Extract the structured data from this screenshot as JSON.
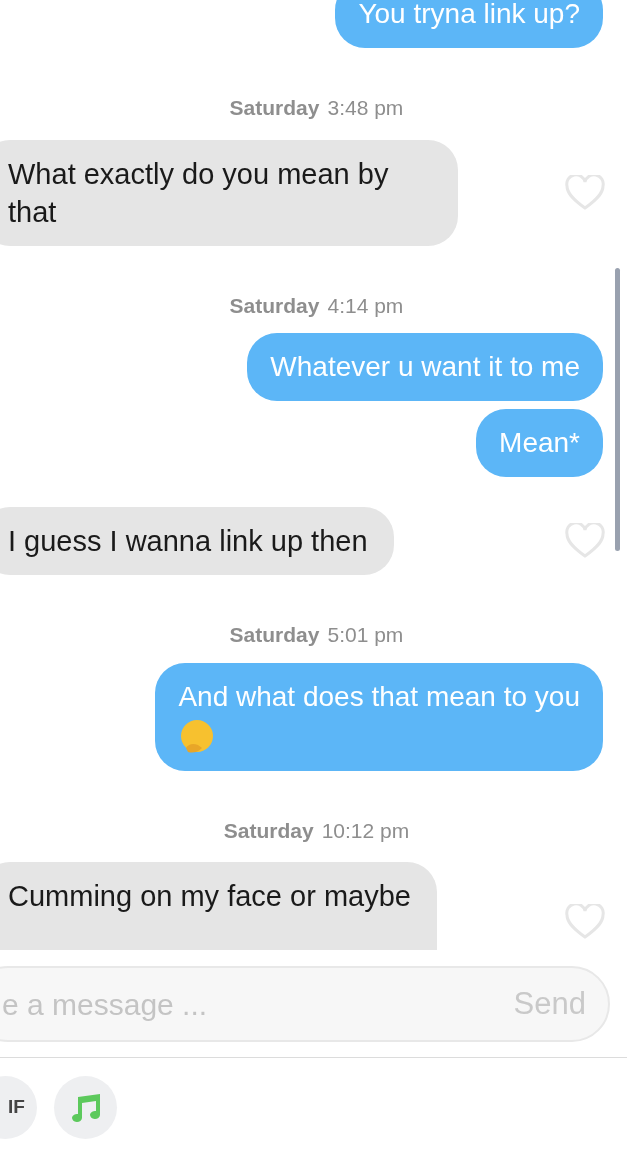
{
  "messages": [
    {
      "kind": "outgoing",
      "text": "You tryna link up?"
    },
    {
      "kind": "timestamp",
      "day": "Saturday",
      "time": "3:48 pm"
    },
    {
      "kind": "incoming",
      "text": "What exactly do you mean by that"
    },
    {
      "kind": "timestamp",
      "day": "Saturday",
      "time": "4:14 pm"
    },
    {
      "kind": "outgoing",
      "text": "Whatever u want it to me"
    },
    {
      "kind": "outgoing",
      "text": "Mean*"
    },
    {
      "kind": "incoming",
      "text": "I guess I wanna link up then"
    },
    {
      "kind": "timestamp",
      "day": "Saturday",
      "time": "5:01 pm"
    },
    {
      "kind": "outgoing",
      "text": "And what does that mean to you",
      "has_emoji": true
    },
    {
      "kind": "timestamp",
      "day": "Saturday",
      "time": "10:12 pm"
    },
    {
      "kind": "incoming",
      "text": "Cumming on my face or maybe"
    }
  ],
  "composer": {
    "placeholder": "e a message ...",
    "send": "Send"
  },
  "attachments": [
    {
      "kind": "gif",
      "label": "IF"
    },
    {
      "kind": "music"
    }
  ]
}
